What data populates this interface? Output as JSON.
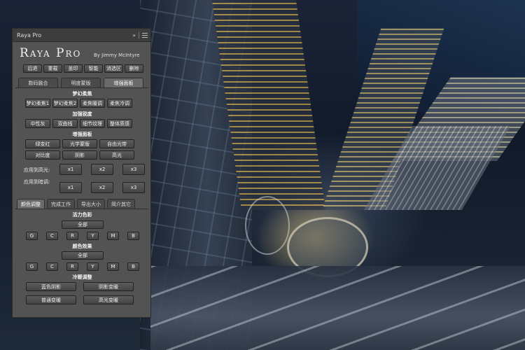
{
  "panel": {
    "tab_title": "Raya Pro",
    "collapse_glyph": "»",
    "logo": "Raya Pro",
    "byline": "By Jimmy McIntyre"
  },
  "toolbar": [
    "后退",
    "重载",
    "盖印",
    "智能",
    "消选区",
    "删除"
  ],
  "main_tabs": [
    {
      "label": "数码融合",
      "active": false
    },
    {
      "label": "明度蒙版",
      "active": false
    },
    {
      "label": "增强面板",
      "active": true
    }
  ],
  "dream": {
    "title": "梦幻柔焦",
    "buttons": [
      "梦幻柔焦1",
      "梦幻柔焦2",
      "柔焦暖调",
      "柔焦冷调"
    ]
  },
  "sharpen": {
    "title": "加强锐度",
    "buttons": [
      "中性灰",
      "双曲线",
      "细节纹理",
      "整体质感"
    ]
  },
  "enhance": {
    "title": "增强面板",
    "row1": [
      "绿变红",
      "光学蒙版",
      "自由光带"
    ],
    "row2": [
      "对比度",
      "阴影",
      "高光"
    ]
  },
  "apply_highlight": {
    "label": "应用到高光:",
    "buttons": [
      "x1",
      "x2",
      "x3"
    ]
  },
  "apply_shadow": {
    "label": "应用到暗调:",
    "buttons": [
      "x1",
      "x2",
      "x3"
    ]
  },
  "sub_tabs": [
    {
      "label": "颜色调整",
      "active": true
    },
    {
      "label": "完成工作",
      "active": false
    },
    {
      "label": "导出大小",
      "active": false
    },
    {
      "label": "简介其它",
      "active": false
    }
  ],
  "vibrance": {
    "title": "活力色彩",
    "all": "全部",
    "channels": [
      "G",
      "C",
      "R",
      "Y",
      "M",
      "B"
    ]
  },
  "color_effect": {
    "title": "颜色效果",
    "all": "全部",
    "channels": [
      "G",
      "C",
      "R",
      "Y",
      "M",
      "B"
    ]
  },
  "warm_cool": {
    "title": "冷暖调整",
    "row1": [
      "蓝色阴影",
      "阴影变暖"
    ],
    "row2": [
      "普通变暖",
      "高光变暖"
    ]
  }
}
